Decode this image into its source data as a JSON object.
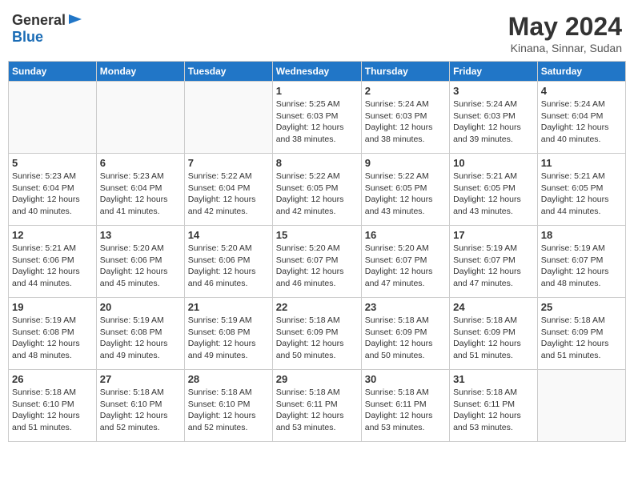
{
  "logo": {
    "general": "General",
    "blue": "Blue"
  },
  "title": {
    "month_year": "May 2024",
    "location": "Kinana, Sinnar, Sudan"
  },
  "days_of_week": [
    "Sunday",
    "Monday",
    "Tuesday",
    "Wednesday",
    "Thursday",
    "Friday",
    "Saturday"
  ],
  "weeks": [
    [
      {
        "day": "",
        "info": ""
      },
      {
        "day": "",
        "info": ""
      },
      {
        "day": "",
        "info": ""
      },
      {
        "day": "1",
        "info": "Sunrise: 5:25 AM\nSunset: 6:03 PM\nDaylight: 12 hours\nand 38 minutes."
      },
      {
        "day": "2",
        "info": "Sunrise: 5:24 AM\nSunset: 6:03 PM\nDaylight: 12 hours\nand 38 minutes."
      },
      {
        "day": "3",
        "info": "Sunrise: 5:24 AM\nSunset: 6:03 PM\nDaylight: 12 hours\nand 39 minutes."
      },
      {
        "day": "4",
        "info": "Sunrise: 5:24 AM\nSunset: 6:04 PM\nDaylight: 12 hours\nand 40 minutes."
      }
    ],
    [
      {
        "day": "5",
        "info": "Sunrise: 5:23 AM\nSunset: 6:04 PM\nDaylight: 12 hours\nand 40 minutes."
      },
      {
        "day": "6",
        "info": "Sunrise: 5:23 AM\nSunset: 6:04 PM\nDaylight: 12 hours\nand 41 minutes."
      },
      {
        "day": "7",
        "info": "Sunrise: 5:22 AM\nSunset: 6:04 PM\nDaylight: 12 hours\nand 42 minutes."
      },
      {
        "day": "8",
        "info": "Sunrise: 5:22 AM\nSunset: 6:05 PM\nDaylight: 12 hours\nand 42 minutes."
      },
      {
        "day": "9",
        "info": "Sunrise: 5:22 AM\nSunset: 6:05 PM\nDaylight: 12 hours\nand 43 minutes."
      },
      {
        "day": "10",
        "info": "Sunrise: 5:21 AM\nSunset: 6:05 PM\nDaylight: 12 hours\nand 43 minutes."
      },
      {
        "day": "11",
        "info": "Sunrise: 5:21 AM\nSunset: 6:05 PM\nDaylight: 12 hours\nand 44 minutes."
      }
    ],
    [
      {
        "day": "12",
        "info": "Sunrise: 5:21 AM\nSunset: 6:06 PM\nDaylight: 12 hours\nand 44 minutes."
      },
      {
        "day": "13",
        "info": "Sunrise: 5:20 AM\nSunset: 6:06 PM\nDaylight: 12 hours\nand 45 minutes."
      },
      {
        "day": "14",
        "info": "Sunrise: 5:20 AM\nSunset: 6:06 PM\nDaylight: 12 hours\nand 46 minutes."
      },
      {
        "day": "15",
        "info": "Sunrise: 5:20 AM\nSunset: 6:07 PM\nDaylight: 12 hours\nand 46 minutes."
      },
      {
        "day": "16",
        "info": "Sunrise: 5:20 AM\nSunset: 6:07 PM\nDaylight: 12 hours\nand 47 minutes."
      },
      {
        "day": "17",
        "info": "Sunrise: 5:19 AM\nSunset: 6:07 PM\nDaylight: 12 hours\nand 47 minutes."
      },
      {
        "day": "18",
        "info": "Sunrise: 5:19 AM\nSunset: 6:07 PM\nDaylight: 12 hours\nand 48 minutes."
      }
    ],
    [
      {
        "day": "19",
        "info": "Sunrise: 5:19 AM\nSunset: 6:08 PM\nDaylight: 12 hours\nand 48 minutes."
      },
      {
        "day": "20",
        "info": "Sunrise: 5:19 AM\nSunset: 6:08 PM\nDaylight: 12 hours\nand 49 minutes."
      },
      {
        "day": "21",
        "info": "Sunrise: 5:19 AM\nSunset: 6:08 PM\nDaylight: 12 hours\nand 49 minutes."
      },
      {
        "day": "22",
        "info": "Sunrise: 5:18 AM\nSunset: 6:09 PM\nDaylight: 12 hours\nand 50 minutes."
      },
      {
        "day": "23",
        "info": "Sunrise: 5:18 AM\nSunset: 6:09 PM\nDaylight: 12 hours\nand 50 minutes."
      },
      {
        "day": "24",
        "info": "Sunrise: 5:18 AM\nSunset: 6:09 PM\nDaylight: 12 hours\nand 51 minutes."
      },
      {
        "day": "25",
        "info": "Sunrise: 5:18 AM\nSunset: 6:09 PM\nDaylight: 12 hours\nand 51 minutes."
      }
    ],
    [
      {
        "day": "26",
        "info": "Sunrise: 5:18 AM\nSunset: 6:10 PM\nDaylight: 12 hours\nand 51 minutes."
      },
      {
        "day": "27",
        "info": "Sunrise: 5:18 AM\nSunset: 6:10 PM\nDaylight: 12 hours\nand 52 minutes."
      },
      {
        "day": "28",
        "info": "Sunrise: 5:18 AM\nSunset: 6:10 PM\nDaylight: 12 hours\nand 52 minutes."
      },
      {
        "day": "29",
        "info": "Sunrise: 5:18 AM\nSunset: 6:11 PM\nDaylight: 12 hours\nand 53 minutes."
      },
      {
        "day": "30",
        "info": "Sunrise: 5:18 AM\nSunset: 6:11 PM\nDaylight: 12 hours\nand 53 minutes."
      },
      {
        "day": "31",
        "info": "Sunrise: 5:18 AM\nSunset: 6:11 PM\nDaylight: 12 hours\nand 53 minutes."
      },
      {
        "day": "",
        "info": ""
      }
    ]
  ]
}
